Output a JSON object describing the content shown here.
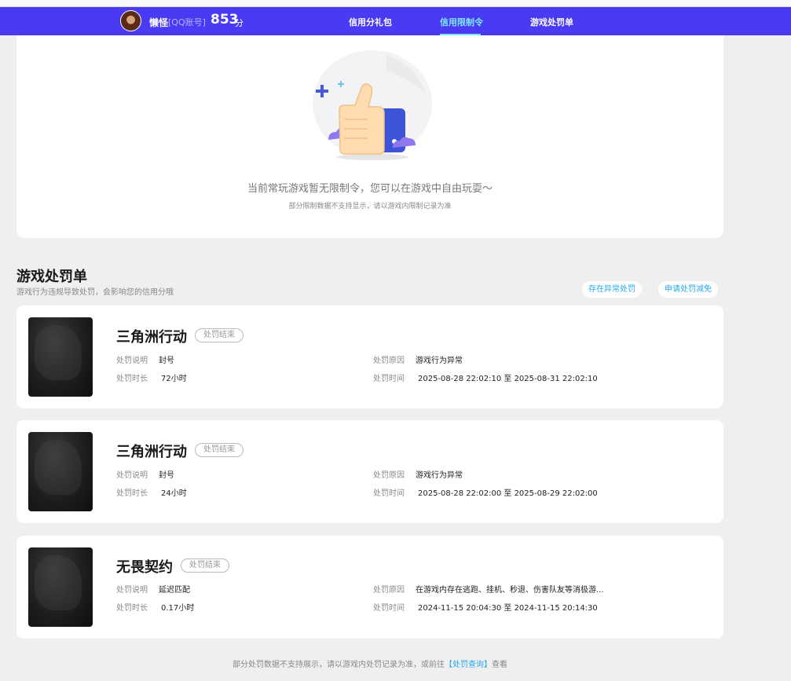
{
  "header": {
    "username": "懒怪",
    "account_tag": "[QQ账号]",
    "score": "853",
    "score_unit": "分",
    "tabs": [
      {
        "label": "信用分礼包",
        "active": false
      },
      {
        "label": "信用限制令",
        "active": true
      },
      {
        "label": "游戏处罚单",
        "active": false
      }
    ],
    "colors": {
      "nav_bg": "#4a3af2",
      "active_tab": "#7fe6ff"
    }
  },
  "restriction": {
    "empty_message": "当前常玩游戏暂无限制令，您可以在游戏中自由玩耍～",
    "empty_sub": "部分限制数据不支持显示，请以游戏内限制记录为准",
    "illustration_icon": "thumbs-up-icon"
  },
  "penalty": {
    "title": "游戏处罚单",
    "subtitle": "游戏行为违规导致处罚，会影响您的信用分哦",
    "actions": [
      "存在异常处罚",
      "申请处罚减免"
    ],
    "field_labels": {
      "desc": "处罚说明",
      "duration": "处罚时长",
      "reason": "处罚原因",
      "time": "处罚时间"
    },
    "records": [
      {
        "game": "三角洲行动",
        "status": "处罚结束",
        "desc": "封号",
        "duration": "72小时",
        "reason": "游戏行为异常",
        "time": "2025-08-28 22:02:10 至 2025-08-31 22:02:10"
      },
      {
        "game": "三角洲行动",
        "status": "处罚结束",
        "desc": "封号",
        "duration": "24小时",
        "reason": "游戏行为异常",
        "time": "2025-08-28 22:02:00 至 2025-08-29 22:02:00"
      },
      {
        "game": "无畏契约",
        "status": "处罚结束",
        "desc": "延迟匹配",
        "duration": "0.17小时",
        "reason": "在游戏内存在逃跑、挂机、秒退、伤害队友等消极游...",
        "time": "2024-11-15 20:04:30 至 2024-11-15 20:14:30"
      }
    ]
  },
  "footer": {
    "note_prefix": "部分处罚数据不支持展示，请以游戏内处罚记录为准，或前往",
    "link": "【处罚查询】",
    "note_suffix": "查看"
  }
}
